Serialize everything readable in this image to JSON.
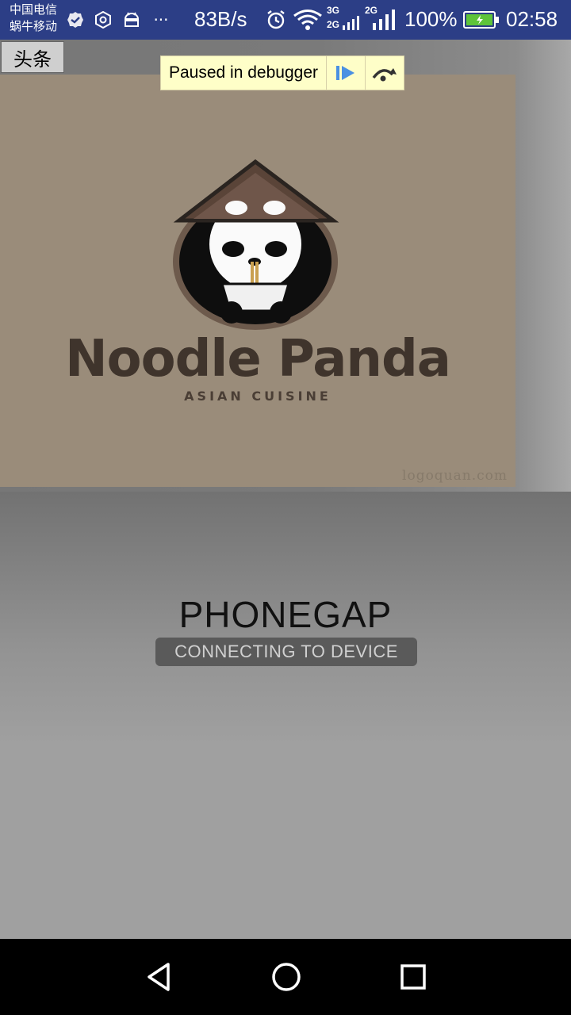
{
  "status_bar": {
    "carrier_line1": "中国电信",
    "carrier_line2": "蜗牛移动",
    "overflow": "···",
    "speed": "83B/s",
    "net1": "3G",
    "net2": "2G",
    "net3": "2G",
    "battery": "100%",
    "time": "02:58",
    "icons": [
      "check-badge-icon",
      "settings-ring-icon",
      "android-icon",
      "alarm-icon",
      "wifi-icon",
      "signal-icon",
      "battery-icon"
    ]
  },
  "toolbar": {
    "toutiao_label": "头条"
  },
  "debugger": {
    "label": "Paused in debugger",
    "icons": [
      "resume-icon",
      "step-over-icon"
    ]
  },
  "logo": {
    "brand": "Noodle Panda",
    "subtitle": "ASIAN CUISINE",
    "watermark": "logoquan.com"
  },
  "phonegap": {
    "title": "PHONEGAP",
    "status": "CONNECTING TO DEVICE"
  },
  "navbar": {
    "icons": [
      "back-icon",
      "home-icon",
      "recents-icon"
    ]
  },
  "colors": {
    "statusbar": "#2c3e86",
    "debug_bg": "#fefec8",
    "accent_blue": "#4a90e2"
  }
}
